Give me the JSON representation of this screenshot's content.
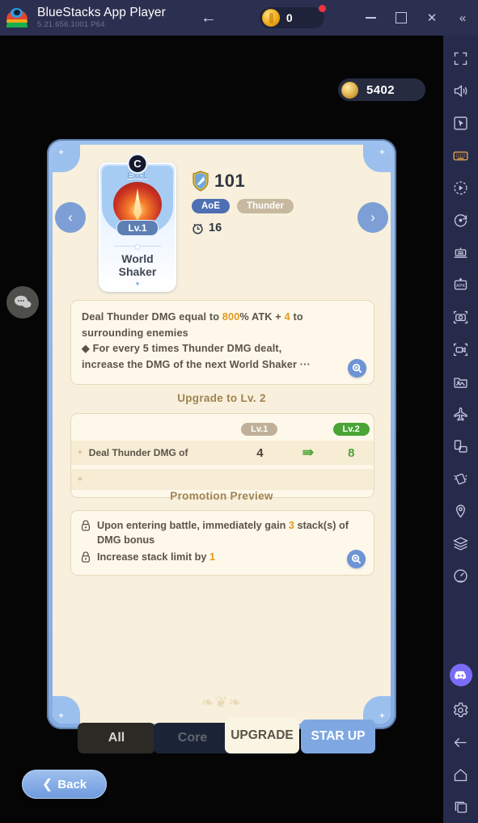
{
  "titlebar": {
    "app_title": "BlueStacks App Player",
    "version": "5.21.656.1001  P64",
    "back_icon": "arrow-left-icon",
    "coin_value": "0",
    "minimize": "",
    "maximize": "",
    "close": "✕",
    "collapse": "«"
  },
  "game": {
    "currency": {
      "value": "5402",
      "icon": "coin-icon"
    },
    "chat_icon": "chat-bubble-icon",
    "nav": {
      "prev": "‹",
      "next": "›"
    }
  },
  "skill": {
    "rarity_letter": "C",
    "excl_label": "Excl.",
    "level_pill": "Lv.1",
    "name_line1": "World",
    "name_line2": "Shaker",
    "power_value": "101",
    "power_icon": "shield-icon",
    "tags": [
      {
        "label": "AoE",
        "kind": "aoe"
      },
      {
        "label": "Thunder",
        "kind": "elem"
      }
    ],
    "cooldown_icon": "cooldown-icon",
    "cooldown_value": "16"
  },
  "description": {
    "line1_a": "Deal Thunder DMG equal to ",
    "line1_val": "800",
    "line1_b": "% ATK + ",
    "line1_val2": "4",
    "line1_c": " to",
    "line2": "surrounding enemies",
    "bullet": "◆",
    "line3": " For every 5 times Thunder DMG dealt,",
    "line4": "increase the DMG of the next World Shaker ",
    "ellipsis": "···",
    "zoom_icon": "magnifier-icon"
  },
  "upgrade": {
    "title": "Upgrade to Lv. 2",
    "col_old": "Lv.1",
    "col_new": "Lv.2",
    "rows": [
      {
        "bullet": "✦",
        "label": "Deal Thunder DMG of",
        "old": "4",
        "arrow": "⇛",
        "new": "8"
      },
      {
        "bullet": "✦",
        "label": "",
        "old": "",
        "arrow": "",
        "new": ""
      }
    ]
  },
  "promotion": {
    "title": "Promotion Preview",
    "items": [
      {
        "icon": "lock-icon",
        "text_a": "Upon entering battle, immediately gain ",
        "value": "3",
        "text_b": " stack(s) of DMG bonus"
      },
      {
        "icon": "lock-icon",
        "text_a": "Increase stack limit by ",
        "value": "1",
        "text_b": ""
      }
    ],
    "zoom_icon": "magnifier-icon"
  },
  "card_ornament": "❧❦❧",
  "tabs": [
    {
      "key": "all",
      "label": "All"
    },
    {
      "key": "core",
      "label": "Core"
    },
    {
      "key": "upgrade",
      "label": "UPGRADE"
    },
    {
      "key": "starup",
      "label": "STAR UP"
    }
  ],
  "back_button": {
    "label": "Back",
    "icon": "arrow-left-icon"
  },
  "sidebar": {
    "items": [
      {
        "name": "fullscreen-icon"
      },
      {
        "name": "volume-icon"
      },
      {
        "name": "cursor-icon"
      },
      {
        "name": "keyboard-icon",
        "active": true
      },
      {
        "name": "macro-play-icon"
      },
      {
        "name": "macro-record-icon"
      },
      {
        "name": "multi-instance-icon"
      },
      {
        "name": "install-apk-icon"
      },
      {
        "name": "screenshot-icon"
      },
      {
        "name": "screen-record-icon"
      },
      {
        "name": "media-manager-icon"
      },
      {
        "name": "airplane-icon"
      },
      {
        "name": "rotate-screen-icon"
      },
      {
        "name": "shake-icon"
      },
      {
        "name": "location-icon"
      },
      {
        "name": "layers-icon"
      },
      {
        "name": "performance-icon"
      }
    ],
    "bottom": [
      {
        "name": "discord-icon"
      },
      {
        "name": "gear-icon"
      },
      {
        "name": "back-icon"
      },
      {
        "name": "home-icon"
      },
      {
        "name": "recents-icon"
      }
    ]
  },
  "colors": {
    "accent_blue": "#7fa8e2",
    "card_cream": "#f8f0dc",
    "amber": "#e29a22",
    "green": "#49a536",
    "sidebar": "#272b4b"
  }
}
